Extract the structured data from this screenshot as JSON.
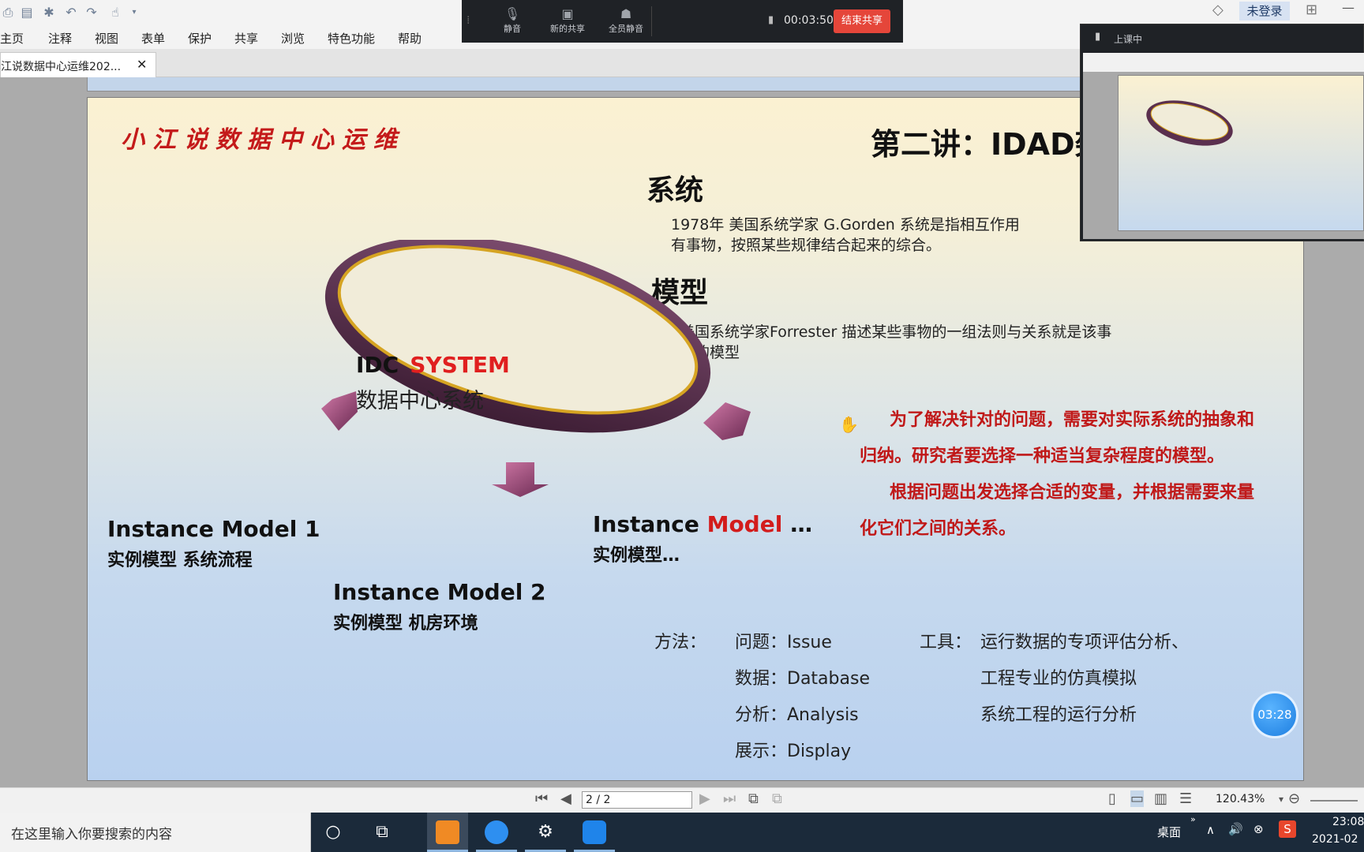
{
  "menu": [
    "主页",
    "注释",
    "视图",
    "表单",
    "保护",
    "共享",
    "浏览",
    "特色功能",
    "帮助"
  ],
  "tab": {
    "title": "江说数据中心运维202...",
    "close_icon": "close-icon"
  },
  "meeting": {
    "mute": "静音",
    "new_share": "新的共享",
    "mute_all": "全员静音",
    "elapsed": "00:03:50",
    "end_share": "结束共享"
  },
  "account": {
    "login": "未登录"
  },
  "preview": {
    "title": "上课中"
  },
  "slide": {
    "brand": "小江说数据中心运维",
    "title": "第二讲：IDAD架",
    "h_system": "系统",
    "system_text_1": "1978年  美国系统学家 G.Gorden    系统是指相互作用",
    "system_text_2": "有事物，按照某些规律结合起来的综合。",
    "h_model": "模型",
    "model_text_1": "美国系统学家Forrester    描述某些事物的一组法则与关系就是该事",
    "model_text_2": "物的模型",
    "red_1": "为了解决针对的问题，需要对实际系统的抽象和归纳。研究者要选择一种适当复杂程度的模型。",
    "red_2": "根据问题出发选择合适的变量，并根据需要来量化它们之间的关系。",
    "idc_1": "IDC",
    "idc_2": "SYSTEM",
    "idc_cn": "数据中心系统",
    "im1_title": "Instance Model 1",
    "im1_sub": "实例模型  系统流程",
    "im2_title": "Instance Model 2",
    "im2_sub": "实例模型   机房环境",
    "im3_a": "Instance",
    "im3_b": "Model",
    "im3_c": "…",
    "im3_sub": "实例模型…",
    "method_label": "方法：",
    "methods": [
      "问题：Issue",
      "数据：Database",
      "分析：Analysis",
      "展示：Display"
    ],
    "tool_label": "工具：",
    "tools": [
      "运行数据的专项评估分析、",
      "工程专业的仿真模拟",
      "系统工程的运行分析"
    ]
  },
  "timer": "03:28",
  "status": {
    "page": "2 / 2",
    "zoom": "120.43%"
  },
  "taskbar": {
    "search_placeholder": "在这里输入你要搜索的内容",
    "desktop": "桌面",
    "time": "23:08",
    "date": "2021-02"
  }
}
